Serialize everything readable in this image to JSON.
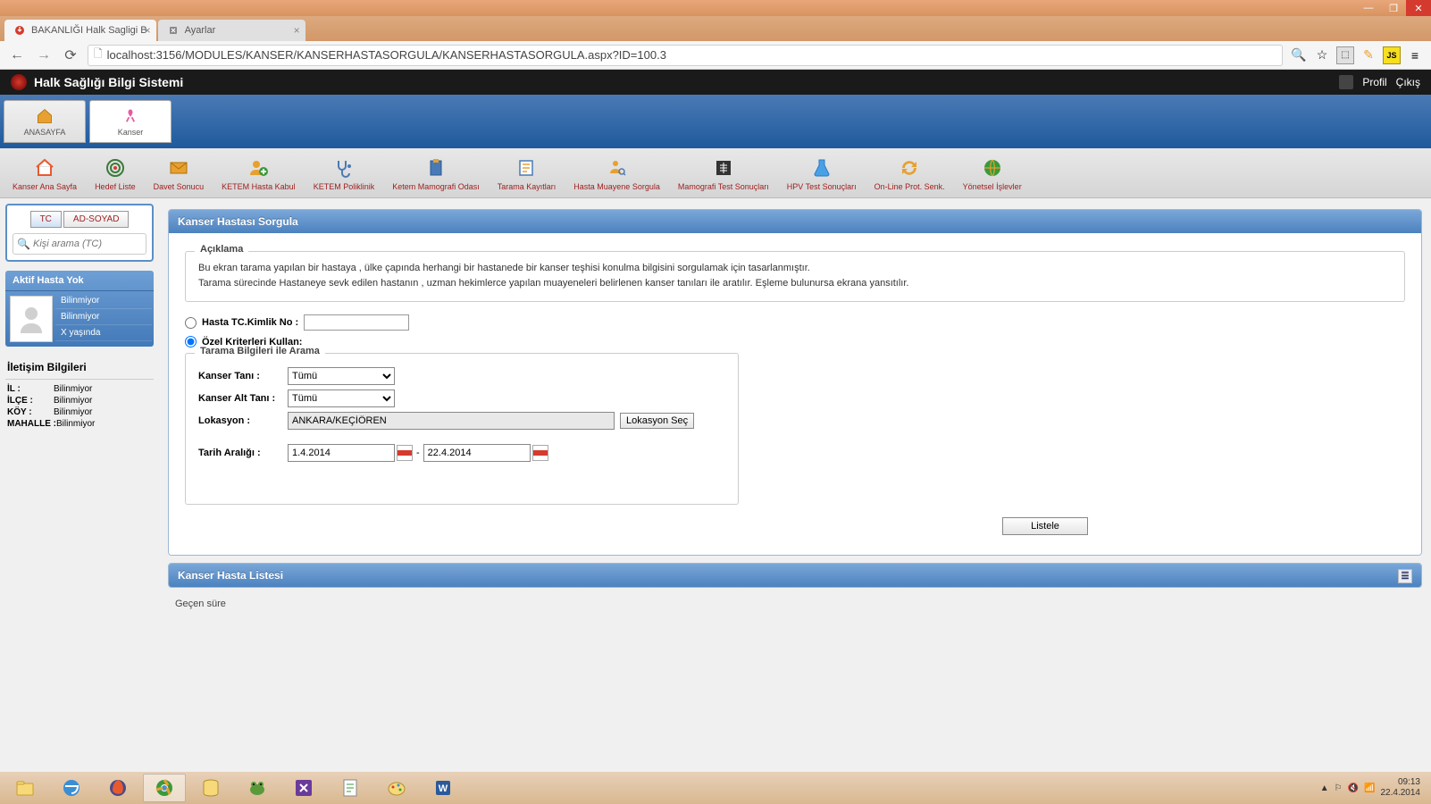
{
  "browser": {
    "tabs": [
      {
        "title": "BAKANLIĞI Halk Sagligi B",
        "active": true
      },
      {
        "title": "Ayarlar",
        "active": false
      }
    ],
    "url": "localhost:3156/MODULES/KANSER/KANSERHASTASORGULA/KANSERHASTASORGULA.aspx?ID=100.3"
  },
  "app": {
    "title": "Halk Sağlığı Bilgi Sistemi",
    "profile_label": "Profil",
    "exit_label": "Çıkış"
  },
  "main_nav": {
    "home": "ANASAYFA",
    "kanser": "Kanser"
  },
  "toolbar": [
    "Kanser Ana Sayfa",
    "Hedef Liste",
    "Davet Sonucu",
    "KETEM Hasta Kabul",
    "KETEM Poliklinik",
    "Ketem Mamografi Odası",
    "Tarama Kayıtları",
    "Hasta Muayene Sorgula",
    "Mamografi Test Sonuçları",
    "HPV Test Sonuçları",
    "On-Line Prot. Senk.",
    "Yönetsel İşlevler"
  ],
  "sidebar": {
    "tab_tc": "TC",
    "tab_name": "AD-SOYAD",
    "search_placeholder": "Kişi arama (TC)",
    "patient_hdr": "Aktif Hasta Yok",
    "rows": [
      "Bilinmiyor",
      "Bilinmiyor",
      "X yaşında"
    ],
    "contact_hdr": "İletişim Bilgileri",
    "contacts": [
      {
        "label": "İL :",
        "value": "Bilinmiyor"
      },
      {
        "label": "İLÇE :",
        "value": "Bilinmiyor"
      },
      {
        "label": "KÖY :",
        "value": "Bilinmiyor"
      },
      {
        "label": "MAHALLE :",
        "value": "Bilinmiyor"
      }
    ]
  },
  "main": {
    "panel_title": "Kanser Hastası Sorgula",
    "desc_legend": "Açıklama",
    "desc_line1": "Bu ekran tarama yapılan bir hastaya , ülke çapında herhangi bir hastanede bir kanser teşhisi konulma bilgisini sorgulamak için tasarlanmıştır.",
    "desc_line2": "Tarama sürecinde Hastaneye sevk edilen hastanın , uzman hekimlerce yapılan muayeneleri belirlenen kanser tanıları ile aratılır. Eşleme bulunursa ekrana yansıtılır.",
    "radio_tc_label": "Hasta TC.Kimlik No :",
    "radio_criteria_label": "Özel Kriterleri Kullan:",
    "search_legend": "Tarama Bilgileri ile Arama",
    "kanser_tani_label": "Kanser Tanı :",
    "kanser_alt_tani_label": "Kanser Alt Tanı :",
    "lokasyon_label": "Lokasyon :",
    "lokasyon_value": "ANKARA/KEÇİÖREN",
    "lokasyon_btn": "Lokasyon Seç",
    "tarih_label": "Tarih Aralığı :",
    "date_from": "1.4.2014",
    "date_to": "22.4.2014",
    "select_default": "Tümü",
    "listele_btn": "Listele",
    "list_panel_title": "Kanser Hasta Listesi",
    "elapsed_label": "Geçen süre"
  },
  "taskbar": {
    "time": "09:13",
    "date": "22.4.2014"
  }
}
